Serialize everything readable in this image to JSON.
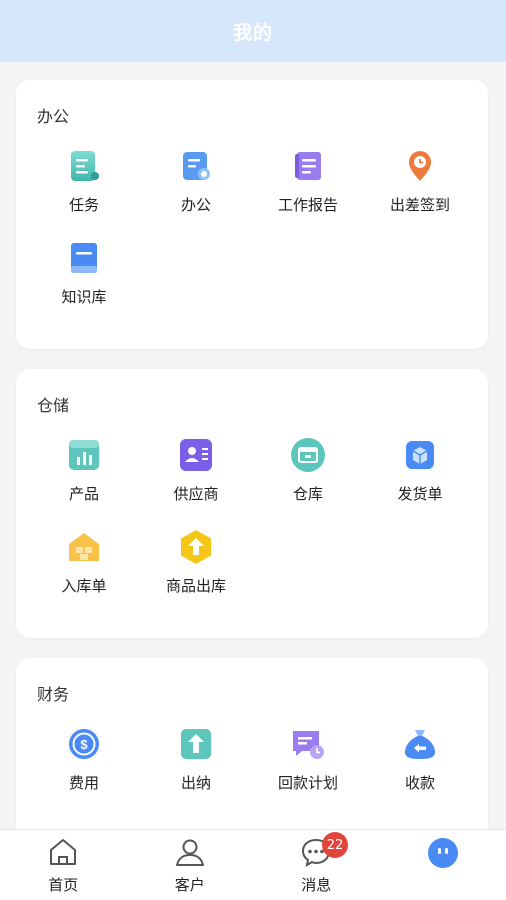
{
  "header": {
    "title": "我的"
  },
  "office": {
    "title": "办公",
    "items": [
      {
        "label": "任务",
        "icon": "task-icon"
      },
      {
        "label": "办公",
        "icon": "office-doc-icon"
      },
      {
        "label": "工作报告",
        "icon": "work-report-icon"
      },
      {
        "label": "出差签到",
        "icon": "location-clock-icon"
      },
      {
        "label": "知识库",
        "icon": "knowledge-book-icon"
      }
    ]
  },
  "storage": {
    "title": "仓储",
    "items": [
      {
        "label": "产品",
        "icon": "product-chart-icon"
      },
      {
        "label": "供应商",
        "icon": "supplier-card-icon"
      },
      {
        "label": "仓库",
        "icon": "warehouse-icon"
      },
      {
        "label": "发货单",
        "icon": "delivery-box-icon"
      },
      {
        "label": "入库单",
        "icon": "inbound-house-icon"
      },
      {
        "label": "商品出库",
        "icon": "outbound-arrow-icon"
      }
    ]
  },
  "finance": {
    "title": "财务",
    "items": [
      {
        "label": "费用",
        "icon": "dollar-coin-icon"
      },
      {
        "label": "出纳",
        "icon": "cashier-icon"
      },
      {
        "label": "回款计划",
        "icon": "payment-plan-icon"
      },
      {
        "label": "收款",
        "icon": "money-bag-icon"
      }
    ]
  },
  "tabbar": {
    "tabs": [
      {
        "label": "首页",
        "icon": "home-icon"
      },
      {
        "label": "客户",
        "icon": "user-icon"
      },
      {
        "label": "消息",
        "icon": "message-icon",
        "badge": "22"
      },
      {
        "label": "",
        "icon": "avatar-icon"
      }
    ]
  },
  "colors": {
    "header_bg": "#d6e6fb",
    "accent_blue": "#4a8af4",
    "badge_red": "#e0453b"
  }
}
